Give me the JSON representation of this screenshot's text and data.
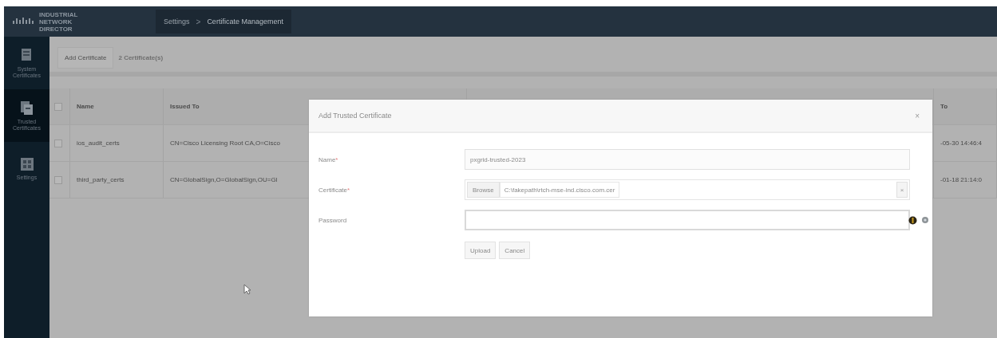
{
  "header": {
    "brand": "INDUSTRIAL NETWORK DIRECTOR",
    "breadcrumb": [
      {
        "label": "Settings",
        "kind": "link"
      },
      {
        "label": ">",
        "kind": "separator"
      },
      {
        "label": "Certificate Management",
        "kind": "current"
      }
    ]
  },
  "sidebar": {
    "items": [
      {
        "label": "System Certificates",
        "selected": false
      },
      {
        "label": "Trusted Certificates",
        "selected": true
      },
      {
        "label": "Settings",
        "selected": false
      }
    ]
  },
  "toolbar": {
    "button": "Add Certificate",
    "count": "2 Certificate(s)"
  },
  "table": {
    "columns": [
      {
        "label": "Name"
      },
      {
        "label": "Issued To"
      },
      {
        "label": "To"
      }
    ],
    "header_checked": false,
    "rows": [
      {
        "checked": false,
        "cells": [
          "ios_audit_certs",
          "CN=Cisco Licensing Root CA,O=Cisco",
          "-05-30 14:46:4"
        ]
      },
      {
        "checked": false,
        "cells": [
          "third_party_certs",
          "CN=GlobalSign,O=GlobalSign,OU=Gl",
          "-01-18 21:14:0"
        ]
      }
    ]
  },
  "dialog": {
    "title": "Add Trusted Certificate",
    "close": "×",
    "fields": [
      {
        "kind": "text",
        "label": "Name",
        "mark": "*",
        "value": "pxgrid-trusted-2023"
      },
      {
        "kind": "file",
        "label": "Certificate",
        "mark": "*",
        "button": "Browse",
        "value": "C:\\fakepath\\rtch-mse-ind.cisco.com.cer",
        "clear": "×"
      },
      {
        "kind": "password",
        "label": "Password"
      }
    ],
    "buttons": [
      "Upload",
      "Cancel"
    ]
  }
}
